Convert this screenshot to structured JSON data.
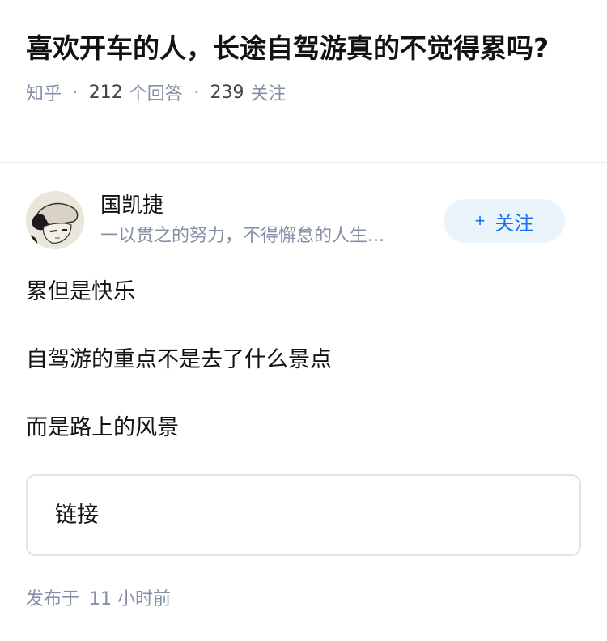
{
  "question": {
    "title": "喜欢开车的人，长途自驾游真的不觉得累吗?",
    "source": "知乎",
    "answers_count": "212",
    "answers_label": "个回答",
    "followers_count": "239",
    "followers_label": "关注"
  },
  "author": {
    "name": "国凯捷",
    "bio": "一以贯之的努力，不得懈怠的人生...",
    "avatar_icon": "anime-character-avatar",
    "follow_plus": "+",
    "follow_label": "关注"
  },
  "answer": {
    "paragraphs": [
      "累但是快乐",
      "自驾游的重点不是去了什么景点",
      "而是路上的风景"
    ]
  },
  "link_card": {
    "label": "链接"
  },
  "footer": {
    "published_prefix": "发布于",
    "published_time": "11 小时前"
  },
  "colors": {
    "accent": "#1772f6",
    "follow_bg": "#ebf3fb",
    "meta_text": "#8590a6"
  }
}
